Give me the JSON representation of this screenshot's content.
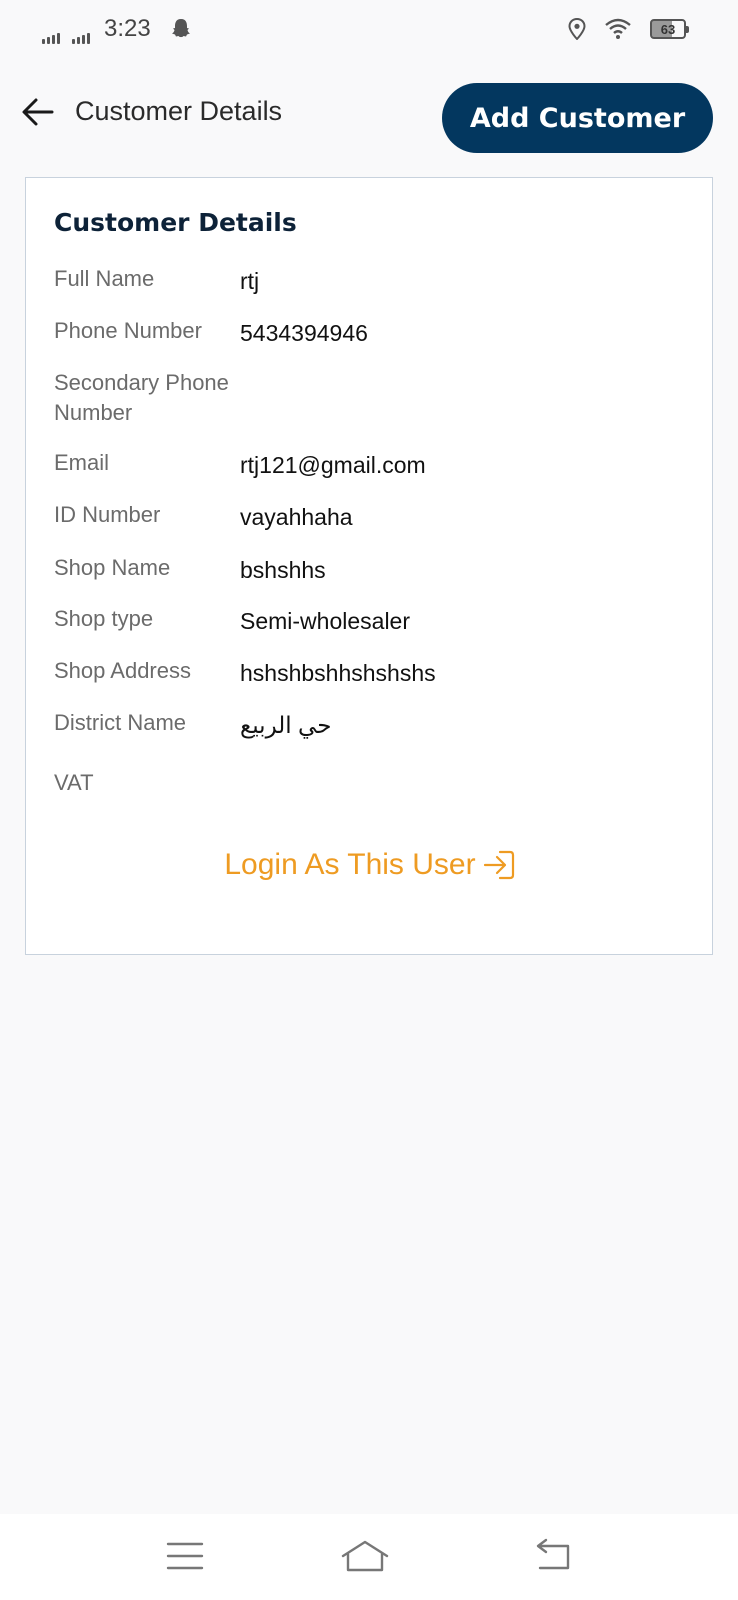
{
  "status_bar": {
    "time": "3:23",
    "battery": "63",
    "icons": [
      "signal-icon",
      "signal-icon",
      "snapchat-icon",
      "location-icon",
      "wifi-icon",
      "battery-icon"
    ]
  },
  "header": {
    "title": "Customer Details",
    "add_button_label": "Add Customer"
  },
  "card": {
    "title": "Customer Details",
    "fields": [
      {
        "label": "Full Name",
        "value": "rtj"
      },
      {
        "label": "Phone Number",
        "value": "5434394946"
      },
      {
        "label": "Secondary Phone Number",
        "value": ""
      },
      {
        "label": "Email",
        "value": "rtj121@gmail.com"
      },
      {
        "label": "ID Number",
        "value": "vayahhaha"
      },
      {
        "label": "Shop Name",
        "value": "bshshhs"
      },
      {
        "label": "Shop type",
        "value": "Semi-wholesaler"
      },
      {
        "label": "Shop Address",
        "value": "hshshbshhshshshs"
      },
      {
        "label": "District Name",
        "value": "حي الربيع"
      },
      {
        "label": "VAT",
        "value": ""
      }
    ],
    "login_link": "Login As This User"
  },
  "colors": {
    "primary": "#03375f",
    "accent": "#ee9b22",
    "background": "#f9f9fa"
  }
}
